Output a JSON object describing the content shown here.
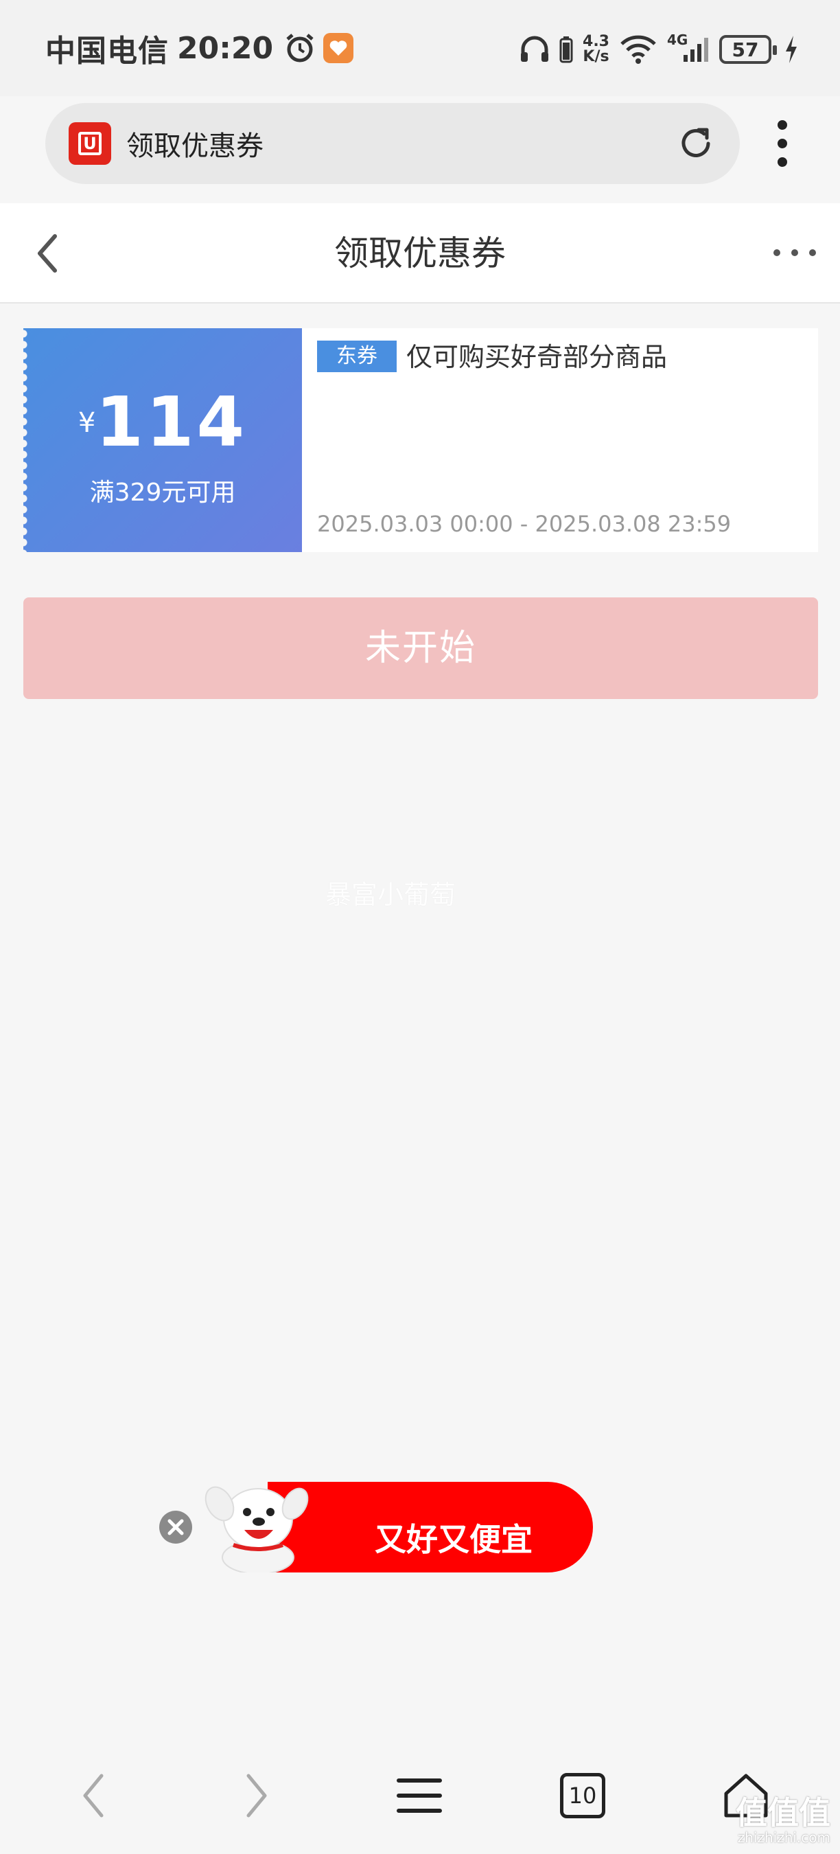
{
  "status_bar": {
    "carrier": "中国电信",
    "time": "20:20",
    "net_speed_value": "4.3",
    "net_speed_unit": "K/s",
    "signal_label": "4G",
    "battery": "57"
  },
  "browser": {
    "address_title": "领取优惠券"
  },
  "header": {
    "title": "领取优惠券"
  },
  "coupon": {
    "currency": "¥",
    "amount": "114",
    "threshold": "满329元可用",
    "tag": "东券",
    "description": "仅可购买好奇部分商品",
    "validity": "2025.03.03 00:00 - 2025.03.08 23:59",
    "color": "#4a8fe0"
  },
  "action": {
    "status_label": "未开始"
  },
  "watermark": "暴富小葡萄",
  "banner": {
    "text": "又好又便宜",
    "color": "#ff0000"
  },
  "bottom_nav": {
    "tab_count": "10"
  },
  "corner_watermark": {
    "main": "值值值",
    "sub": "zhizhizhi.com"
  }
}
